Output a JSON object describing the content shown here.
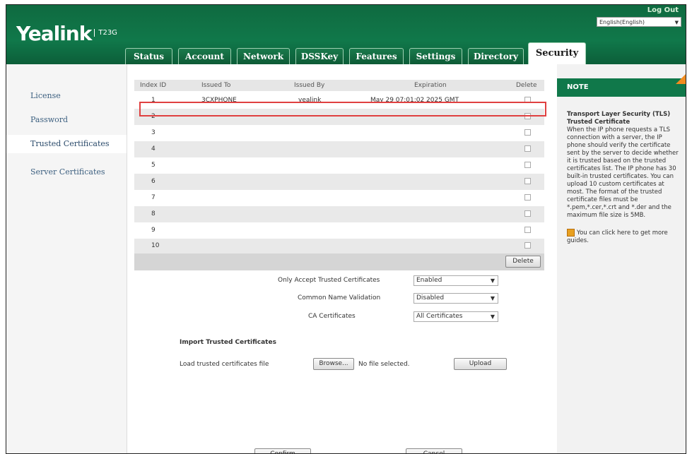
{
  "header": {
    "brand": "Yealink",
    "model": "T23G",
    "logout_label": "Log Out",
    "language": "English(English)"
  },
  "tabs": [
    {
      "label": "Status"
    },
    {
      "label": "Account"
    },
    {
      "label": "Network"
    },
    {
      "label": "DSSKey"
    },
    {
      "label": "Features"
    },
    {
      "label": "Settings"
    },
    {
      "label": "Directory"
    },
    {
      "label": "Security",
      "active": true
    }
  ],
  "sidebar": {
    "items": [
      {
        "label": "License"
      },
      {
        "label": "Password"
      },
      {
        "label": "Trusted Certificates",
        "active": true
      },
      {
        "label": "Server Certificates"
      }
    ]
  },
  "table": {
    "columns": [
      "Index ID",
      "Issued To",
      "Issued By",
      "Expiration",
      "Delete"
    ],
    "rows": [
      {
        "index": "1",
        "issued_to": "3CXPHONE",
        "issued_by": "yealink",
        "expiration": "May 29 07:01:02 2025 GMT"
      },
      {
        "index": "2",
        "issued_to": "",
        "issued_by": "",
        "expiration": ""
      },
      {
        "index": "3",
        "issued_to": "",
        "issued_by": "",
        "expiration": ""
      },
      {
        "index": "4",
        "issued_to": "",
        "issued_by": "",
        "expiration": ""
      },
      {
        "index": "5",
        "issued_to": "",
        "issued_by": "",
        "expiration": ""
      },
      {
        "index": "6",
        "issued_to": "",
        "issued_by": "",
        "expiration": ""
      },
      {
        "index": "7",
        "issued_to": "",
        "issued_by": "",
        "expiration": ""
      },
      {
        "index": "8",
        "issued_to": "",
        "issued_by": "",
        "expiration": ""
      },
      {
        "index": "9",
        "issued_to": "",
        "issued_by": "",
        "expiration": ""
      },
      {
        "index": "10",
        "issued_to": "",
        "issued_by": "",
        "expiration": ""
      }
    ],
    "delete_label": "Delete"
  },
  "settings": {
    "only_accept_label": "Only Accept Trusted Certificates",
    "only_accept_value": "Enabled",
    "common_name_label": "Common Name Validation",
    "common_name_value": "Disabled",
    "ca_label": "CA Certificates",
    "ca_value": "All Certificates"
  },
  "import": {
    "title": "Import Trusted Certificates",
    "load_label": "Load trusted certificates file",
    "browse_label": "Browse...",
    "no_file": "No file selected.",
    "upload_label": "Upload"
  },
  "footer": {
    "confirm_label": "Confirm",
    "cancel_label": "Cancel"
  },
  "note": {
    "title": "NOTE",
    "heading1": "Transport Layer Security (TLS)",
    "heading2": "Trusted Certificate",
    "body": "When the IP phone requests a TLS connection with a server, the IP phone should verify the certificate sent by the server to decide whether it is trusted based on the trusted certificates list. The IP phone has 30 built-in trusted certificates. You can upload 10 custom certificates at most. The format of the trusted certificate files must be *.pem,*.cer,*.crt and *.der and the maximum file size is 5MB.",
    "guide": "You can click here to get more guides."
  },
  "colors": {
    "header_green": "#10784a",
    "note_accent": "#f28c1f",
    "highlight_red": "#e04040"
  }
}
